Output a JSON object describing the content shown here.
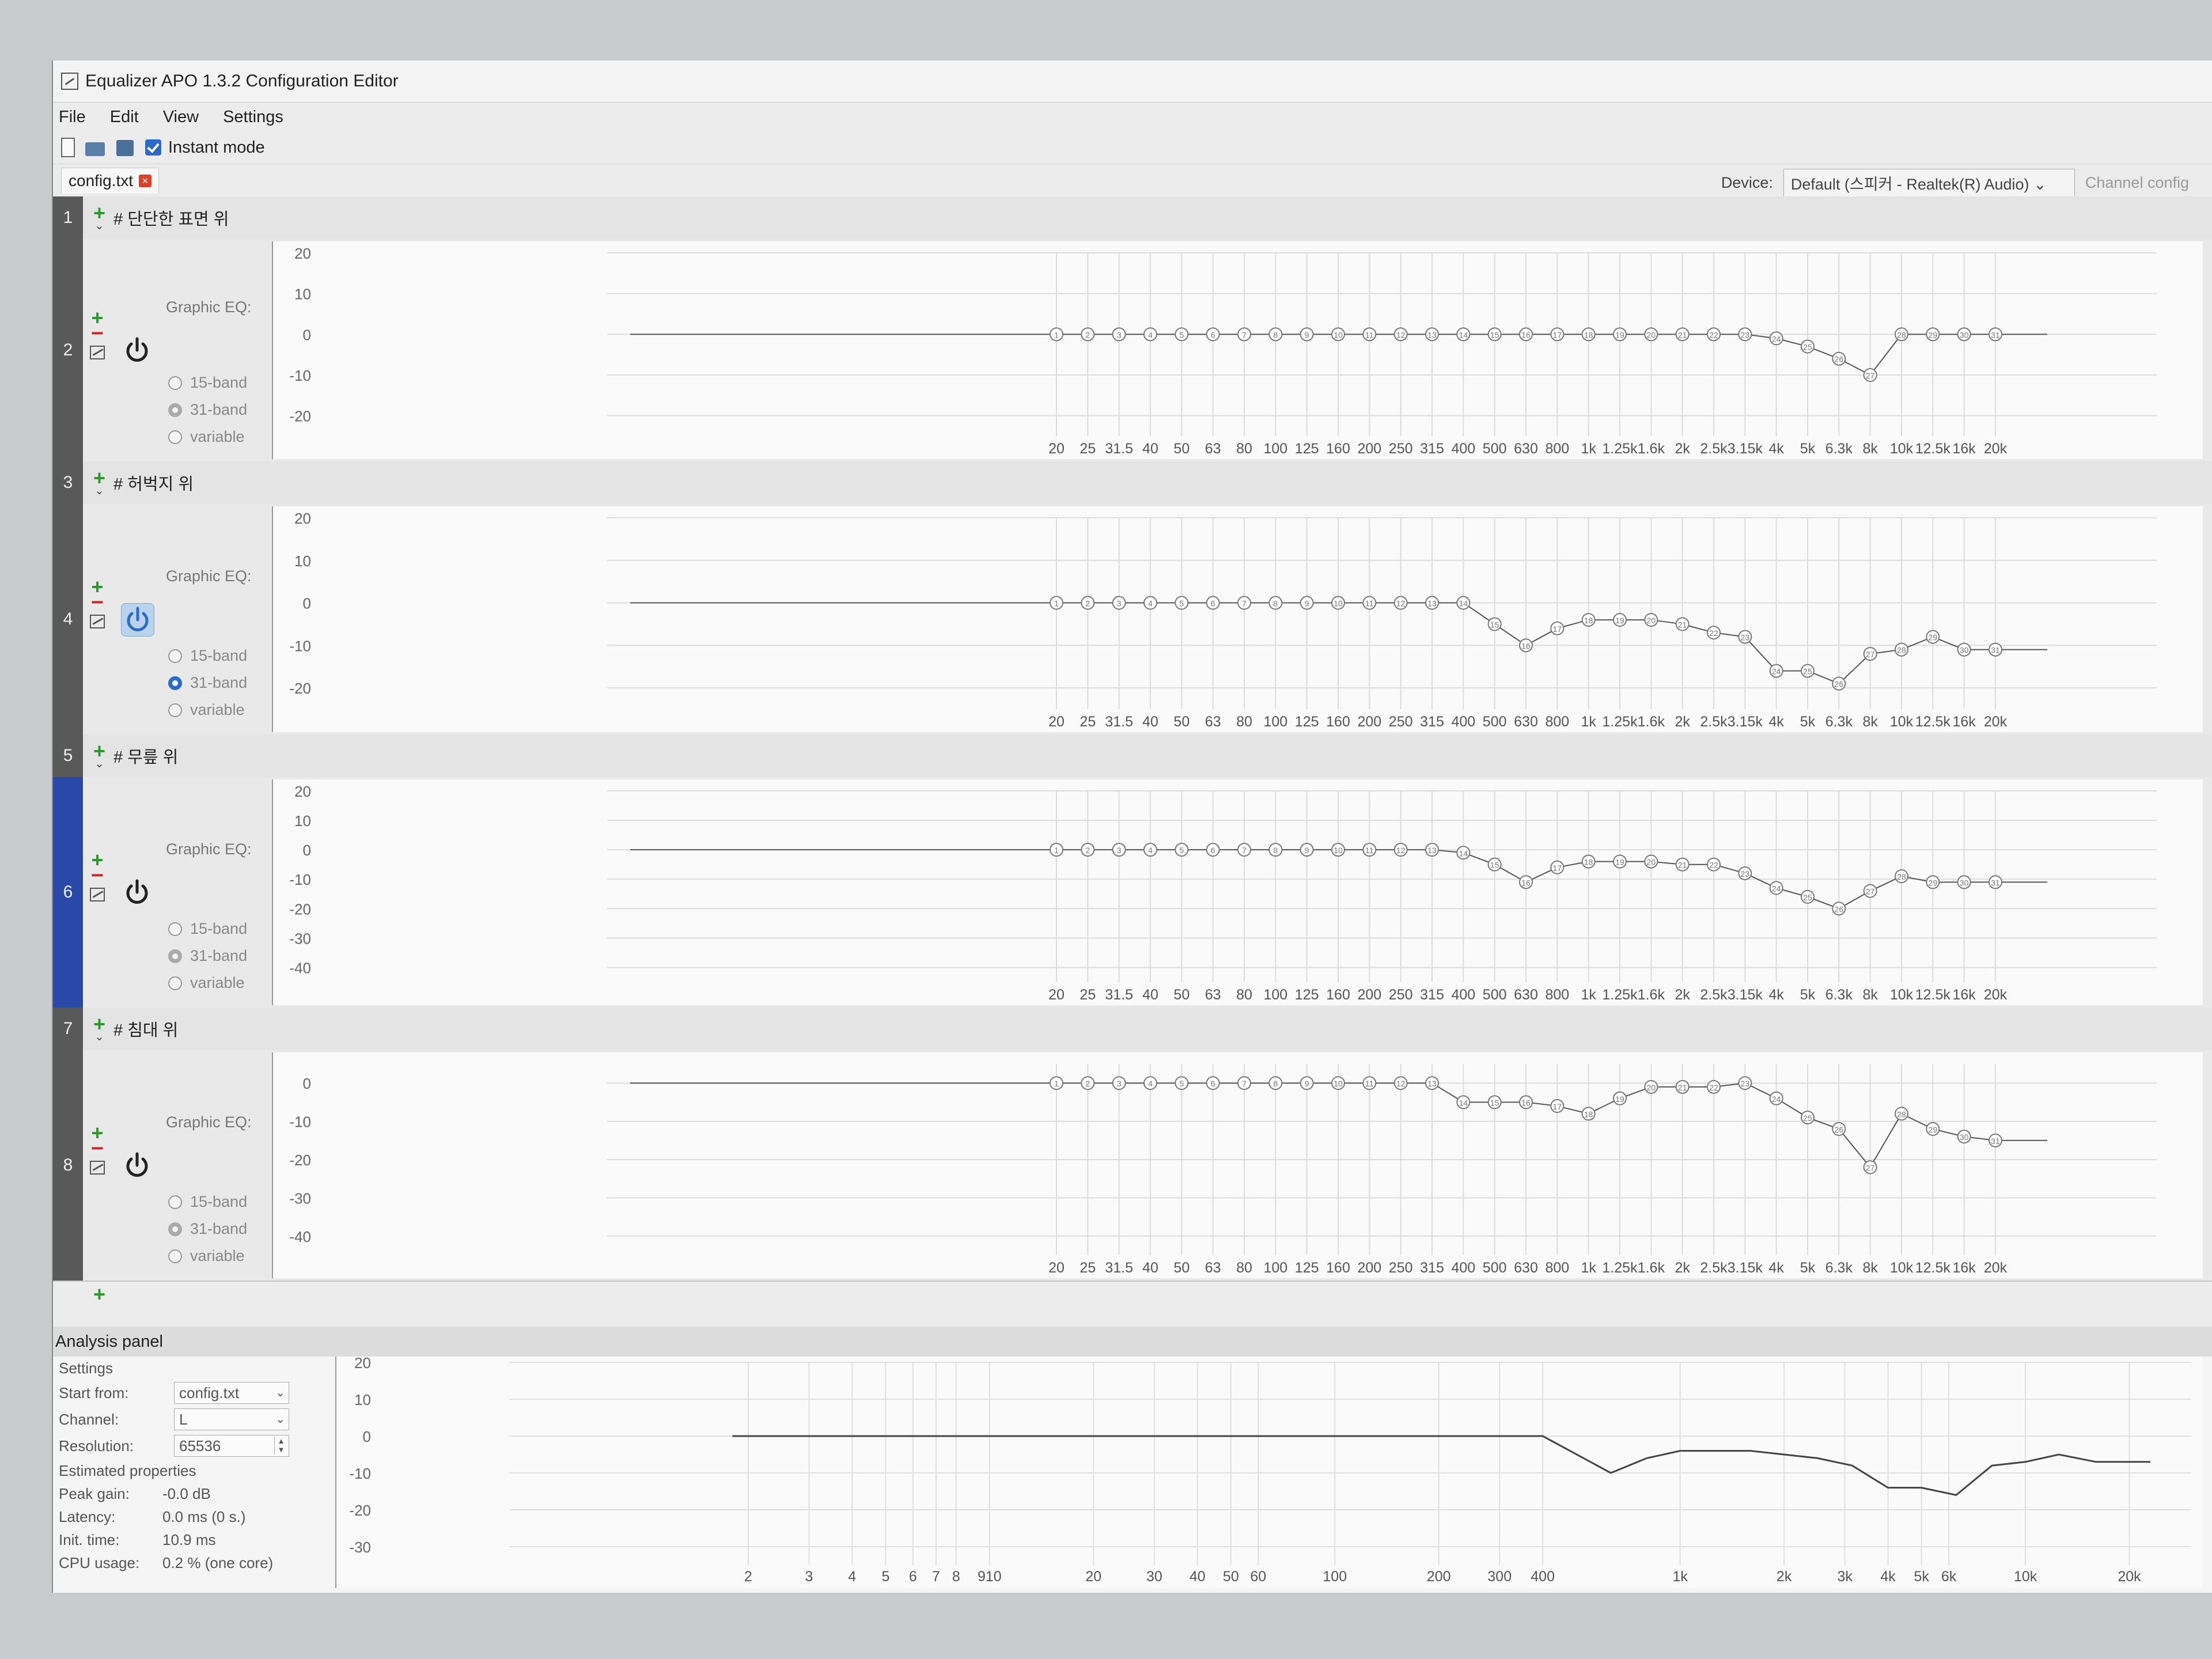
{
  "window": {
    "title": "Equalizer APO 1.3.2 Configuration Editor"
  },
  "menu": [
    "File",
    "Edit",
    "View",
    "Settings"
  ],
  "toolbar": {
    "instant_mode_label": "Instant mode",
    "instant_mode_checked": true
  },
  "tab": {
    "name": "config.txt"
  },
  "device": {
    "label": "Device:",
    "value": "Default (스피커 - Realtek(R) Audio)",
    "channel_config_label": "Channel config"
  },
  "eq_common": {
    "label": "Graphic EQ:",
    "radio_15": "15-band",
    "radio_31": "31-band",
    "radio_variable": "variable",
    "freq_labels": [
      "20",
      "25",
      "31.5",
      "40",
      "50",
      "63",
      "80",
      "100",
      "125",
      "160",
      "200",
      "250",
      "315",
      "400",
      "500",
      "630",
      "800",
      "1k",
      "1.25k",
      "1.6k",
      "2k",
      "2.5k",
      "3.15k",
      "4k",
      "5k",
      "6.3k",
      "8k",
      "10k",
      "12.5k",
      "16k",
      "20k"
    ]
  },
  "rows": [
    {
      "num": "1",
      "comment": "# 단단한 표면 위"
    },
    {
      "num": "2",
      "power_active": false,
      "selected_band": "31-band",
      "y_ticks": [
        "20",
        "10",
        "0",
        "-10",
        "-20"
      ],
      "ylim": [
        -25,
        20
      ],
      "gains": [
        0,
        0,
        0,
        0,
        0,
        0,
        0,
        0,
        0,
        0,
        0,
        0,
        0,
        0,
        0,
        0,
        0,
        0,
        0,
        0,
        0,
        0,
        0,
        -1,
        -3,
        -6,
        -10,
        0,
        0,
        0,
        0
      ]
    },
    {
      "num": "3",
      "comment": "# 허벅지 위"
    },
    {
      "num": "4",
      "power_active": true,
      "selected_band": "31-band",
      "y_ticks": [
        "20",
        "10",
        "0",
        "-10",
        "-20"
      ],
      "ylim": [
        -25,
        20
      ],
      "gains": [
        0,
        0,
        0,
        0,
        0,
        0,
        0,
        0,
        0,
        0,
        0,
        0,
        0,
        0,
        -5,
        -10,
        -6,
        -4,
        -4,
        -4,
        -5,
        -7,
        -8,
        -16,
        -16,
        -19,
        -12,
        -11,
        -8,
        -11,
        -11
      ]
    },
    {
      "num": "5",
      "comment": "# 무릎 위"
    },
    {
      "num": "6",
      "power_active": false,
      "selected_band": "31-band",
      "selected": true,
      "y_ticks": [
        "20",
        "10",
        "0",
        "-10",
        "-20",
        "-30",
        "-40"
      ],
      "ylim": [
        -45,
        20
      ],
      "gains": [
        0,
        0,
        0,
        0,
        0,
        0,
        0,
        0,
        0,
        0,
        0,
        0,
        0,
        -1,
        -5,
        -11,
        -6,
        -4,
        -4,
        -4,
        -5,
        -5,
        -8,
        -13,
        -16,
        -20,
        -14,
        -9,
        -11,
        -11,
        -11
      ]
    },
    {
      "num": "7",
      "comment": "# 침대 위"
    },
    {
      "num": "8",
      "power_active": false,
      "selected_band": "31-band",
      "y_ticks": [
        "0",
        "-10",
        "-20",
        "-30",
        "-40"
      ],
      "ylim": [
        -45,
        5
      ],
      "gains": [
        0,
        0,
        0,
        0,
        0,
        0,
        0,
        0,
        0,
        0,
        0,
        0,
        0,
        -5,
        -5,
        -5,
        -6,
        -8,
        -4,
        -1,
        -1,
        -1,
        0,
        -4,
        -9,
        -12,
        -22,
        -8,
        -12,
        -14,
        -15
      ]
    }
  ],
  "analysis": {
    "header": "Analysis panel",
    "settings_label": "Settings",
    "start_from_label": "Start from:",
    "start_from_value": "config.txt",
    "channel_label": "Channel:",
    "channel_value": "L",
    "resolution_label": "Resolution:",
    "resolution_value": "65536",
    "estimated_label": "Estimated properties",
    "peak_gain_label": "Peak gain:",
    "peak_gain_value": "-0.0 dB",
    "latency_label": "Latency:",
    "latency_value": "0.0 ms (0 s.)",
    "init_time_label": "Init. time:",
    "init_time_value": "10.9 ms",
    "cpu_label": "CPU usage:",
    "cpu_value": "0.2 % (one core)",
    "y_ticks": [
      "20",
      "10",
      "0",
      "-10",
      "-20",
      "-30"
    ],
    "x_ticks": [
      "2",
      "3",
      "4",
      "5",
      "6",
      "7",
      "8",
      "910",
      "20",
      "30",
      "40",
      "50",
      "60",
      "100",
      "200",
      "300",
      "400",
      "1k",
      "2k",
      "3k",
      "4k",
      "5k",
      "6k",
      "10k",
      "20k"
    ],
    "x_tick_values": [
      2,
      3,
      4,
      5,
      6,
      7,
      8,
      10,
      20,
      30,
      40,
      50,
      60,
      100,
      200,
      300,
      400,
      1000,
      2000,
      3000,
      4000,
      5000,
      6000,
      10000,
      20000
    ],
    "response_freqs": [
      20,
      400,
      630,
      800,
      1000,
      1250,
      1600,
      2000,
      2500,
      3150,
      4000,
      5000,
      6300,
      8000,
      10000,
      12500,
      16000,
      20000
    ],
    "response_gains": [
      0,
      0,
      -10,
      -6,
      -4,
      -4,
      -4,
      -5,
      -6,
      -8,
      -14,
      -14,
      -16,
      -8,
      -7,
      -5,
      -7,
      -7
    ]
  }
}
